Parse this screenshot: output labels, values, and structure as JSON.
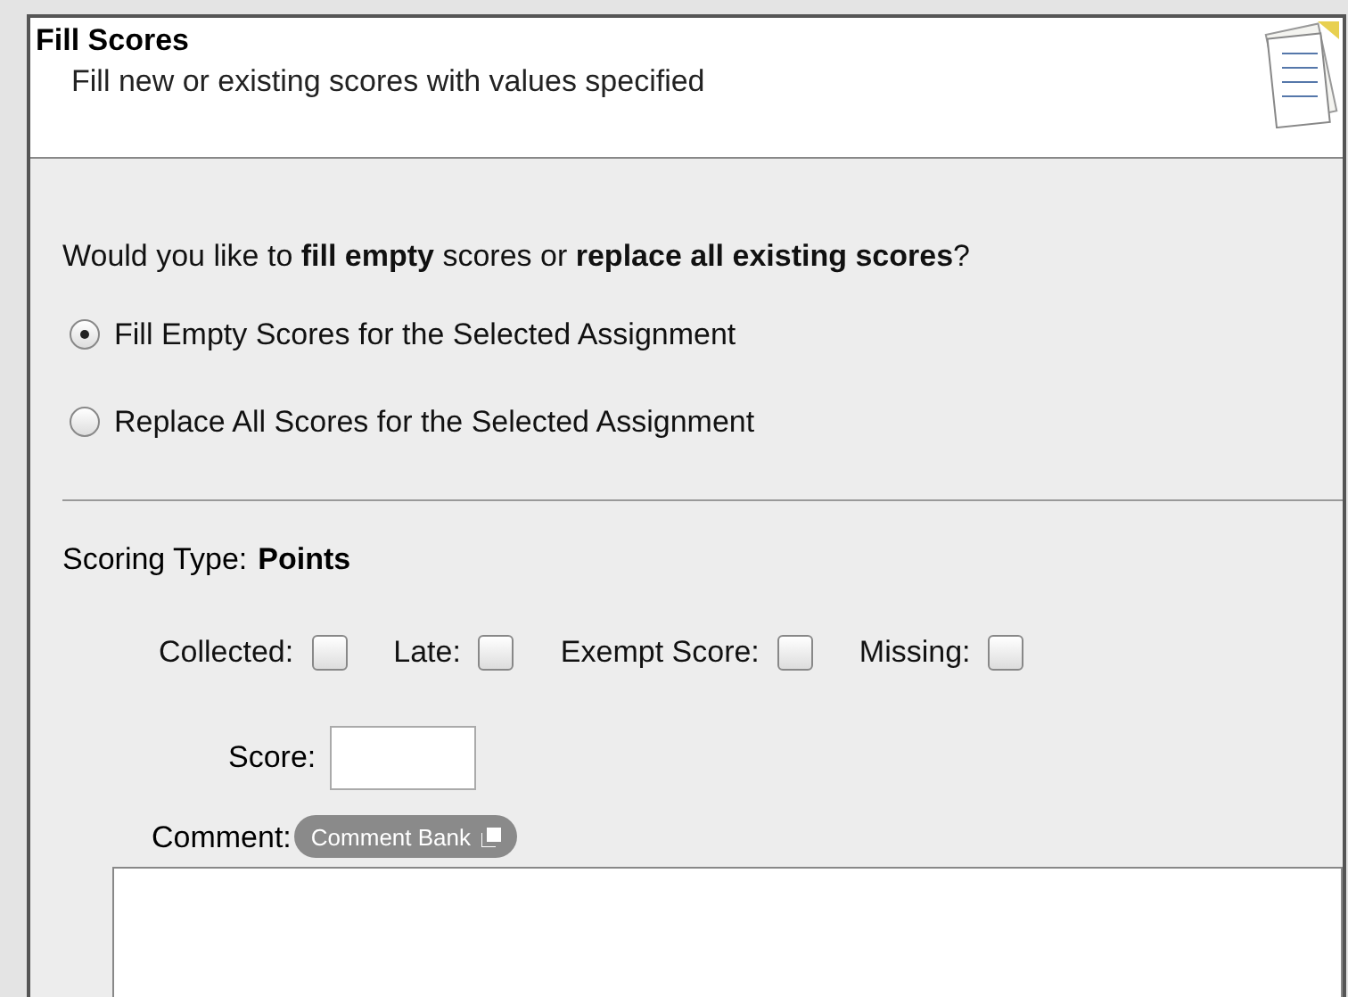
{
  "header": {
    "title": "Fill Scores",
    "subtitle": "Fill new or existing scores with values specified"
  },
  "question": "Would you like to **fill empty** scores or **replace all existing scores**?",
  "fill_options": [
    {
      "label": "Fill Empty Scores for the Selected Assignment",
      "selected": true
    },
    {
      "label": "Replace All Scores for the Selected Assignment",
      "selected": false
    }
  ],
  "scoring_type": {
    "label": "Scoring Type:",
    "value": "Points"
  },
  "flags": [
    {
      "label": "Collected:",
      "checked": false
    },
    {
      "label": "Late:",
      "checked": false
    },
    {
      "label": "Exempt Score:",
      "checked": false
    },
    {
      "label": "Missing:",
      "checked": false
    }
  ],
  "score": {
    "label": "Score:"
  },
  "comment": {
    "label": "Comment:",
    "bank_button": "Comment Bank"
  }
}
